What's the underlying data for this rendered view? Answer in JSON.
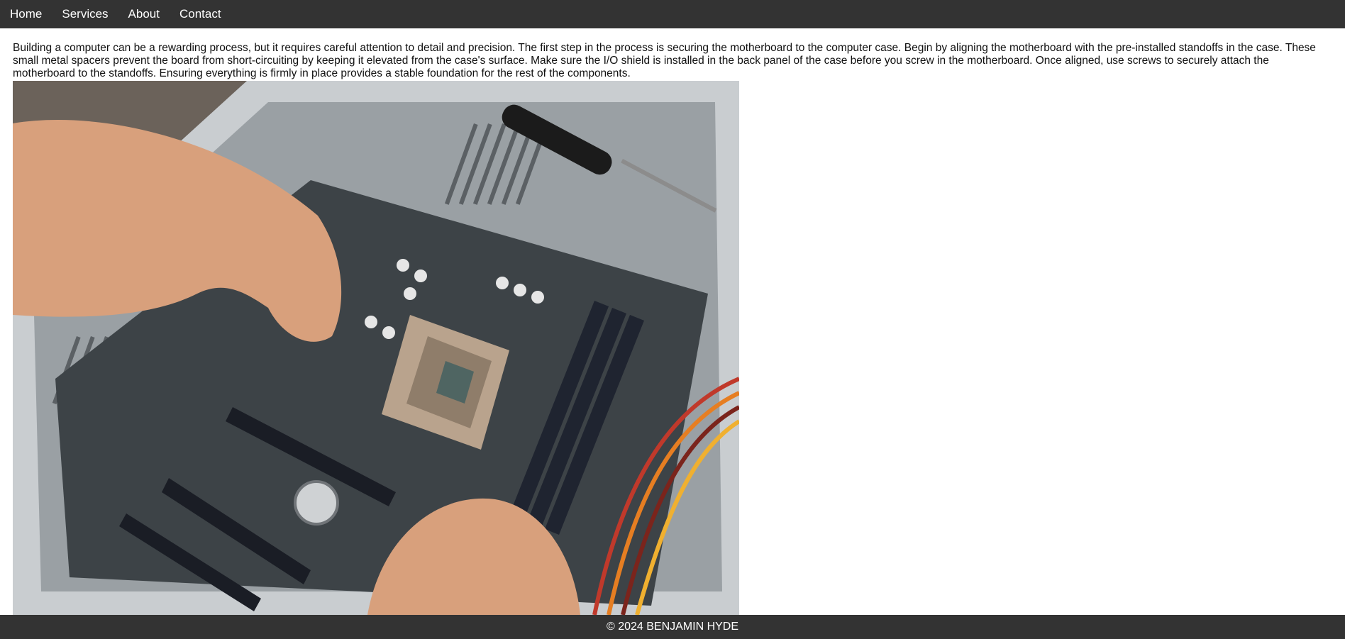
{
  "nav": {
    "items": [
      {
        "label": "Home"
      },
      {
        "label": "Services"
      },
      {
        "label": "About"
      },
      {
        "label": "Contact"
      }
    ]
  },
  "main": {
    "paragraph": "Building a computer can be a rewarding process, but it requires careful attention to detail and precision. The first step in the process is securing the motherboard to the computer case. Begin by aligning the motherboard with the pre-installed standoffs in the case. These small metal spacers prevent the board from short-circuiting by keeping it elevated from the case's surface. Make sure the I/O shield is installed in the back panel of the case before you screw in the motherboard. Once aligned, use screws to securely attach the motherboard to the standoffs. Ensuring everything is firmly in place provides a stable foundation for the rest of the components."
  },
  "footer": {
    "text": "© 2024 BENJAMIN HYDE"
  },
  "colors": {
    "nav_bg": "#333333",
    "nav_text": "#ffffff",
    "page_bg": "#ffffff",
    "footer_bg": "#333333"
  }
}
